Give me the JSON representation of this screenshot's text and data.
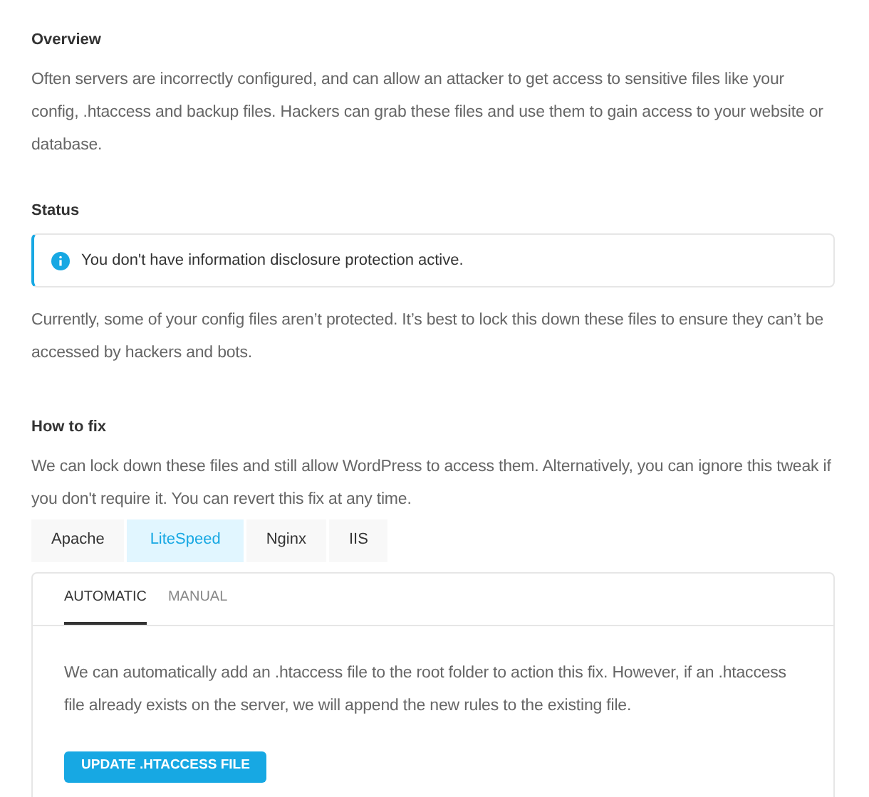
{
  "overview": {
    "heading": "Overview",
    "text": "Often servers are incorrectly configured, and can allow an attacker to get access to sensitive files like your config, .htaccess and backup files. Hackers can grab these files and use them to gain access to your website or database."
  },
  "status": {
    "heading": "Status",
    "alert": {
      "kind": "info",
      "text": "You don't have information disclosure protection active."
    },
    "text": "Currently, some of your config files aren’t protected. It’s best to lock this down these files to ensure they can’t be accessed by hackers and bots."
  },
  "how_to_fix": {
    "heading": "How to fix",
    "text": "We can lock down these files and still allow WordPress to access them. Alternatively, you can ignore this tweak if you don't require it. You can revert this fix at any time."
  },
  "server_tabs": [
    {
      "label": "Apache",
      "selected": false
    },
    {
      "label": "LiteSpeed",
      "selected": true
    },
    {
      "label": "Nginx",
      "selected": false
    },
    {
      "label": "IIS",
      "selected": false
    }
  ],
  "mode_tabs": [
    {
      "label": "AUTOMATIC",
      "selected": true
    },
    {
      "label": "MANUAL",
      "selected": false
    }
  ],
  "panel": {
    "text": "We can automatically add an .htaccess file to the root folder to action this fix. However, if an .htaccess file already exists on the server, we will append the new rules to the existing file.",
    "button": "UPDATE .HTACCESS FILE"
  }
}
